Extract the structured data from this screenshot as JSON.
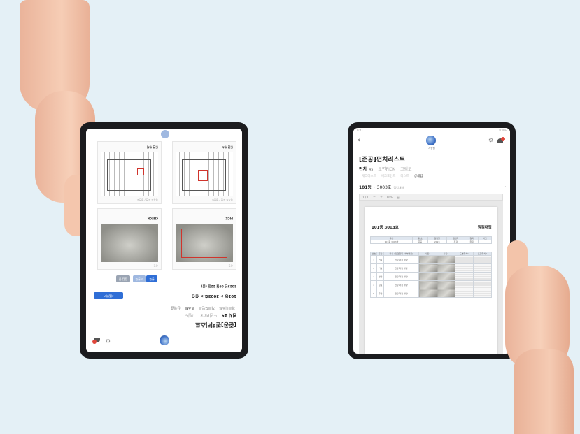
{
  "right_tablet": {
    "status": {
      "time": "9:41",
      "battery": "100%"
    },
    "logo_label": "자공원",
    "title": "[준공]펀치리스트",
    "tabs": [
      {
        "label": "펀치",
        "count": "45",
        "active": true
      },
      {
        "label": "도면PICK",
        "active": false
      },
      {
        "label": "그림도",
        "active": false
      }
    ],
    "subtabs": [
      {
        "label": "체크리스트",
        "active": false
      },
      {
        "label": "체크포인트",
        "active": false
      },
      {
        "label": "리스트",
        "active": false
      },
      {
        "label": "상세업",
        "active": true
      }
    ],
    "unit": {
      "building": "101동",
      "room": "3003호",
      "suffix": "점검내역"
    },
    "toolbar": {
      "page": "1 / 1",
      "zoom": "80%"
    },
    "document": {
      "heading_left": "101동 3003호",
      "heading_right": "점검대장",
      "summary_headers": [
        "구분",
        "동/호",
        "점검일",
        "점검자",
        "결과",
        "비고"
      ],
      "summary_row": [
        "101동 3003호",
        "준공",
        "2023",
        "점검",
        "완료",
        ""
      ],
      "detail_headers": [
        "번호",
        "공간",
        "위치 / 점검항목 (세부내용)",
        "사진1",
        "사진2",
        "도면위치1",
        "도면위치2"
      ],
      "rows": [
        {
          "no": "1",
          "space": "거실",
          "item": "천장 마감 불량"
        },
        {
          "no": "2",
          "space": "거실",
          "item": "천장 마감 불량"
        },
        {
          "no": "3",
          "space": "안방",
          "item": "천장 마감 불량"
        },
        {
          "no": "4",
          "space": "침실",
          "item": "천장 마감 불량"
        },
        {
          "no": "5",
          "space": "주방",
          "item": "천장 마감 불량"
        }
      ]
    }
  },
  "left_tablet": {
    "title": "[준공]펀치리스트",
    "tabs": [
      "펀치 45",
      "도면PICK",
      "그림도"
    ],
    "subtabs": [
      "체크리스트",
      "체크포인트",
      "리스트",
      "상세업"
    ],
    "unit": "101동 > 3003호 > 점검",
    "date": "2023년 09월 22일 (금)",
    "save_button": "저장하기",
    "cards": [
      {
        "header": "위치도 도면 / 평면도",
        "caption": "도면 위치",
        "kind": "plan"
      },
      {
        "header": "위치도 도면 / 평면도",
        "caption": "도면 위치",
        "kind": "plan"
      },
      {
        "header": "사진",
        "caption": "PICK",
        "kind": "photo"
      },
      {
        "header": "사진",
        "caption": "CHECK",
        "kind": "photo"
      }
    ],
    "buttons": [
      "완료",
      "미완료",
      "점검 중"
    ]
  }
}
